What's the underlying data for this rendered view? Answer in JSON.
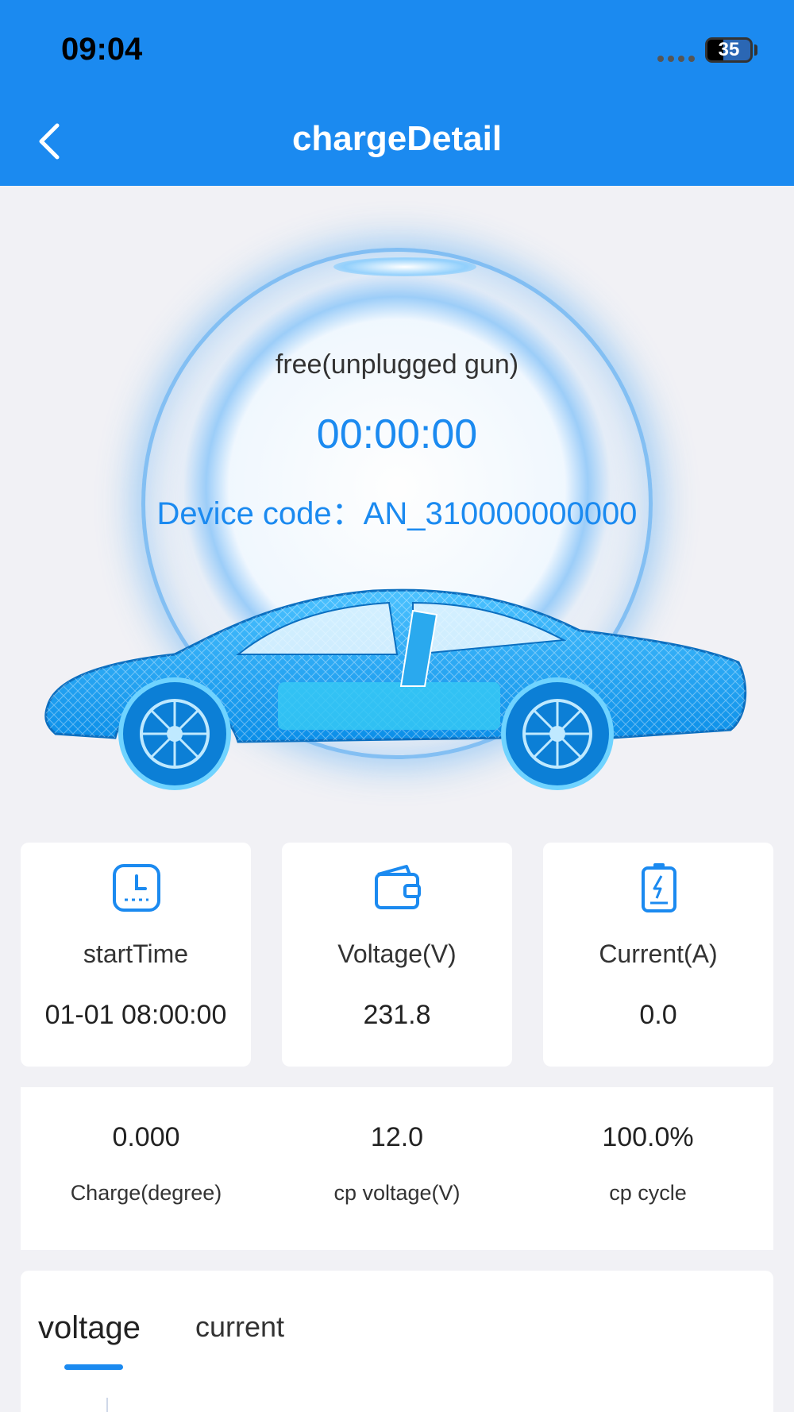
{
  "status_bar": {
    "time": "09:04",
    "battery": "35"
  },
  "header": {
    "title": "chargeDetail"
  },
  "hero": {
    "status": "free(unplugged gun)",
    "timer": "00:00:00",
    "device_code": "Device code：AN_310000000000"
  },
  "stats": [
    {
      "label": "startTime",
      "value": "01-01 08:00:00",
      "icon": "clock-icon"
    },
    {
      "label": "Voltage(V)",
      "value": "231.8",
      "icon": "wallet-icon"
    },
    {
      "label": "Current(A)",
      "value": "0.0",
      "icon": "battery-charging-icon"
    }
  ],
  "metrics": [
    {
      "value": "0.000",
      "label": "Charge(degree)"
    },
    {
      "value": "12.0",
      "label": "cp voltage(V)"
    },
    {
      "value": "100.0%",
      "label": "cp cycle"
    }
  ],
  "chart_tabs": {
    "voltage": "voltage",
    "current": "current",
    "active": "voltage"
  },
  "colors": {
    "primary": "#1b8af0",
    "background": "#f1f1f5"
  }
}
